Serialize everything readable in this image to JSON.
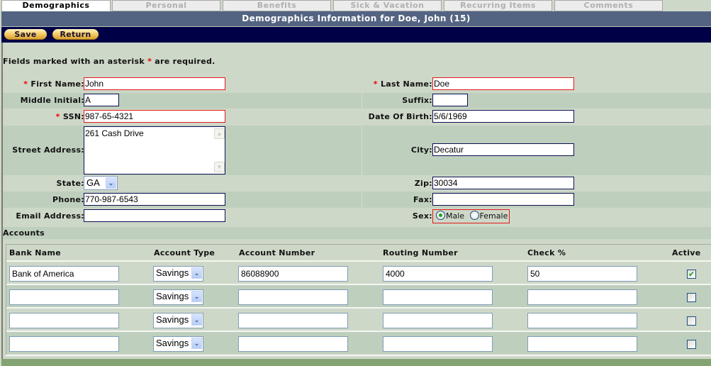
{
  "tabs": [
    {
      "label": "Demographics",
      "active": true
    },
    {
      "label": "Personal",
      "active": false
    },
    {
      "label": "Benefits",
      "active": false
    },
    {
      "label": "Sick & Vacation",
      "active": false
    },
    {
      "label": "Recurring Items",
      "active": false
    },
    {
      "label": "Comments",
      "active": false
    }
  ],
  "header": {
    "title": "Demographics Information for Doe, John (15)"
  },
  "toolbar": {
    "save_label": "Save",
    "return_label": "Return"
  },
  "form": {
    "required_note_prefix": "Fields marked with an asterisk",
    "required_note_star": "*",
    "required_note_suffix": "are required.",
    "first_name": {
      "label": "First Name:",
      "value": "John",
      "required": true
    },
    "last_name": {
      "label": "Last Name:",
      "value": "Doe",
      "required": true
    },
    "middle_initial": {
      "label": "Middle Initial:",
      "value": "A"
    },
    "suffix": {
      "label": "Suffix:",
      "value": ""
    },
    "ssn": {
      "label": "SSN:",
      "value": "987-65-4321",
      "required": true
    },
    "dob": {
      "label": "Date Of Birth:",
      "value": "5/6/1969"
    },
    "street": {
      "label": "Street Address:",
      "value": "261 Cash Drive"
    },
    "city": {
      "label": "City:",
      "value": "Decatur"
    },
    "state": {
      "label": "State:",
      "value": "GA"
    },
    "zip": {
      "label": "Zip:",
      "value": "30034"
    },
    "phone": {
      "label": "Phone:",
      "value": "770-987-6543"
    },
    "fax": {
      "label": "Fax:",
      "value": ""
    },
    "email": {
      "label": "Email Address:",
      "value": ""
    },
    "sex": {
      "label": "Sex:",
      "options": [
        "Male",
        "Female"
      ],
      "selected": "Male"
    },
    "star": "*"
  },
  "accounts": {
    "title": "Accounts",
    "columns": [
      "Bank Name",
      "Account Type",
      "Account Number",
      "Routing Number",
      "Check %",
      "Active"
    ],
    "rows": [
      {
        "bank_name": "Bank of America",
        "account_type": "Savings",
        "account_number": "86088900",
        "routing_number": "4000",
        "check_pct": "50",
        "active": true
      },
      {
        "bank_name": "",
        "account_type": "Savings",
        "account_number": "",
        "routing_number": "",
        "check_pct": "",
        "active": false
      },
      {
        "bank_name": "",
        "account_type": "Savings",
        "account_number": "",
        "routing_number": "",
        "check_pct": "",
        "active": false
      },
      {
        "bank_name": "",
        "account_type": "Savings",
        "account_number": "",
        "routing_number": "",
        "check_pct": "",
        "active": false
      }
    ]
  },
  "icons": {
    "dropdown": "chevron-down-icon",
    "scroll_up": "scroll-up-icon",
    "scroll_down": "scroll-down-icon",
    "check": "checkmark-icon"
  }
}
